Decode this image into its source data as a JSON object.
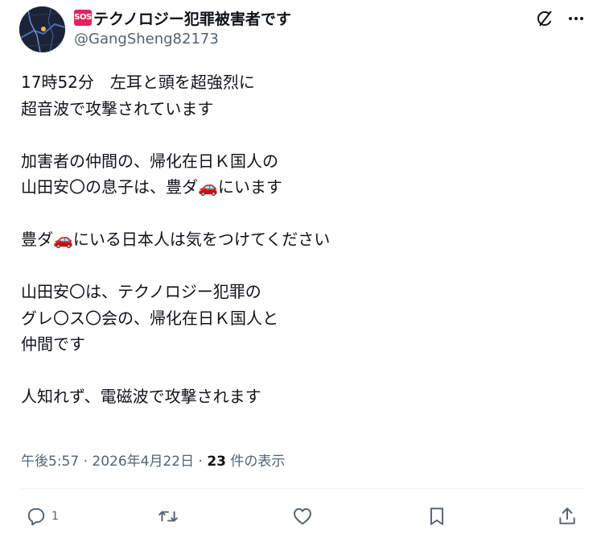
{
  "author": {
    "badge": "SOS",
    "display_name": "テクノロジー犯罪被害者です",
    "handle": "@GangSheng82173"
  },
  "post": {
    "lines": [
      "17時52分　左耳と頭を超強烈に",
      "超音波で攻撃されています",
      "",
      "加害者の仲間の、帰化在日Ｋ国人の",
      "山田安〇の息子は、豊ダ🚗にいます",
      "",
      "豊ダ🚗にいる日本人は気をつけてください",
      "",
      "山田安〇は、テクノロジー犯罪の",
      "グレ〇ス〇会の、帰化在日Ｋ国人と",
      "仲間です",
      "",
      "人知れず、電磁波で攻撃されます"
    ]
  },
  "meta": {
    "time": "午後5:57",
    "separator": " · ",
    "date": "2026年4月22日",
    "views_count": "23",
    "views_label": " 件の表示"
  },
  "actions": {
    "reply_count": "1"
  },
  "icons": {
    "top": [
      "grok-icon",
      "more-icon"
    ],
    "actions": [
      "reply-icon",
      "retweet-icon",
      "like-icon",
      "bookmark-icon",
      "share-icon"
    ]
  },
  "colors": {
    "text": "#0f1419",
    "secondary": "#536471",
    "badge": "#e0245e",
    "divider": "#eff3f4"
  }
}
